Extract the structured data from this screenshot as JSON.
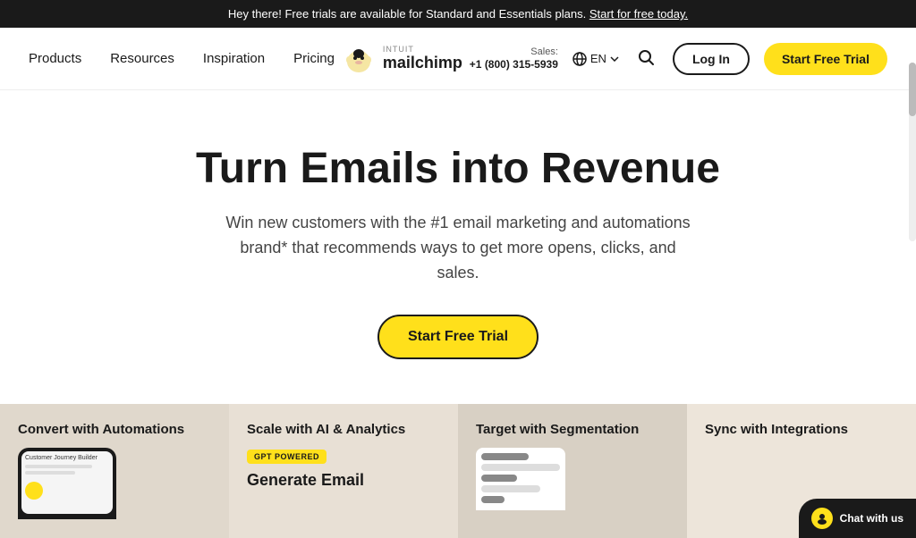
{
  "announcement": {
    "text": "Hey there! Free trials are available for Standard and Essentials plans.",
    "link_text": "Start for free today.",
    "link_url": "#"
  },
  "nav": {
    "products_label": "Products",
    "resources_label": "Resources",
    "inspiration_label": "Inspiration",
    "pricing_label": "Pricing",
    "logo_intuit": "INTUIT",
    "logo_brand": "mailchimp",
    "sales_label": "Sales:",
    "phone": "+1 (800) 315-5939",
    "lang": "EN",
    "login_label": "Log In",
    "trial_label": "Start Free Trial"
  },
  "hero": {
    "headline": "Turn Emails into Revenue",
    "subheadline": "Win new customers with the #1 email marketing and automations brand* that recommends ways to get more opens, clicks, and sales.",
    "cta_label": "Start Free Trial"
  },
  "features": [
    {
      "title": "Convert with Automations",
      "screen_label": "Customer Journey Builder"
    },
    {
      "title": "Scale with AI & Analytics",
      "badge": "GPT POWERED",
      "card_title": "Generate Email"
    },
    {
      "title": "Target with Segmentation"
    },
    {
      "title": "Sync with Integrations",
      "chat_label": "Chat with us"
    }
  ]
}
